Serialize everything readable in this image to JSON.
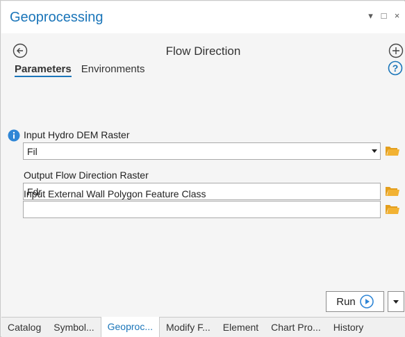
{
  "pane": {
    "title": "Geoprocessing",
    "controls": {
      "pin": "▾",
      "maximize": "□",
      "close": "×"
    }
  },
  "tool": {
    "title": "Flow Direction"
  },
  "tabs": [
    {
      "label": "Parameters",
      "active": true
    },
    {
      "label": "Environments",
      "active": false
    }
  ],
  "params": [
    {
      "label": "Input Hydro DEM Raster",
      "value": "Fil",
      "has_dropdown": true,
      "has_info": true
    },
    {
      "label": "Output Flow Direction Raster",
      "value": "Fdr",
      "has_dropdown": false,
      "has_info": false
    },
    {
      "label": "Input External Wall Polygon Feature Class",
      "value": "",
      "has_dropdown": false,
      "has_info": false
    }
  ],
  "run": {
    "label": "Run"
  },
  "bottom_tabs": [
    {
      "label": "Catalog",
      "active": false
    },
    {
      "label": "Symbol...",
      "active": false
    },
    {
      "label": "Geoproc...",
      "active": true
    },
    {
      "label": "Modify F...",
      "active": false
    },
    {
      "label": "Element",
      "active": false
    },
    {
      "label": "Chart Pro...",
      "active": false
    },
    {
      "label": "History",
      "active": false
    }
  ],
  "colors": {
    "accent": "#1a75b9",
    "folder": "#f2b233",
    "info": "#2f86d6"
  },
  "icons": [
    "back-arrow-icon",
    "add-icon",
    "help-icon",
    "info-icon",
    "folder-icon",
    "run-play-icon"
  ]
}
